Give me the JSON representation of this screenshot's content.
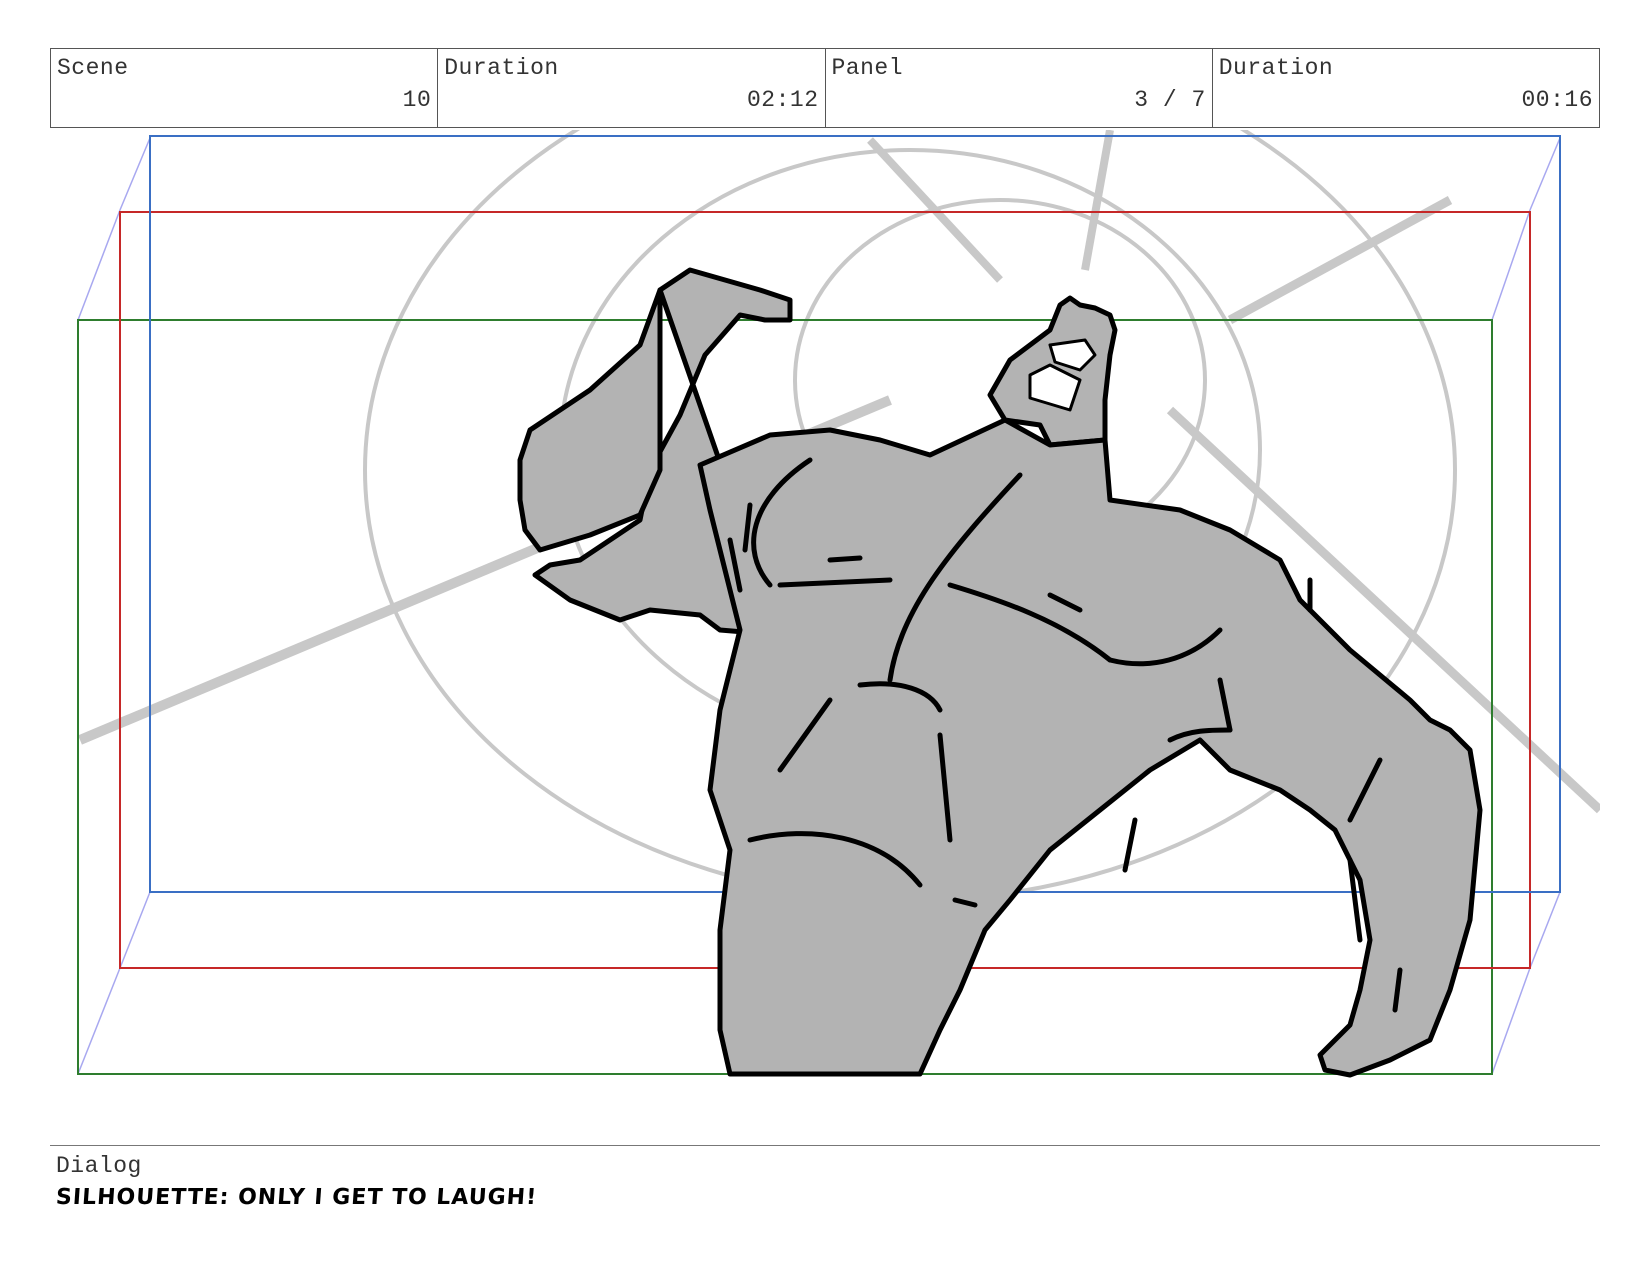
{
  "header": {
    "scene_label": "Scene",
    "scene_value": "10",
    "duration_label": "Duration",
    "duration_value": "02:12",
    "panel_label": "Panel",
    "panel_value": "3 / 7",
    "panel_duration_label": "Duration",
    "panel_duration_value": "00:16"
  },
  "frame_guides": {
    "colors": {
      "outer": "#2e7d2e",
      "middle": "#c62828",
      "inner": "#3a6fc4",
      "perspective": "#a8a8f0"
    }
  },
  "drawing": {
    "subject": "muscular-silhouette-figure",
    "fill_color": "#b3b3b3",
    "line_color": "#000000",
    "background_sketch_color": "#c8c8c8"
  },
  "dialog": {
    "label": "Dialog",
    "text": "SILHOUETTE: ONLY I GET TO LAUGH!"
  }
}
